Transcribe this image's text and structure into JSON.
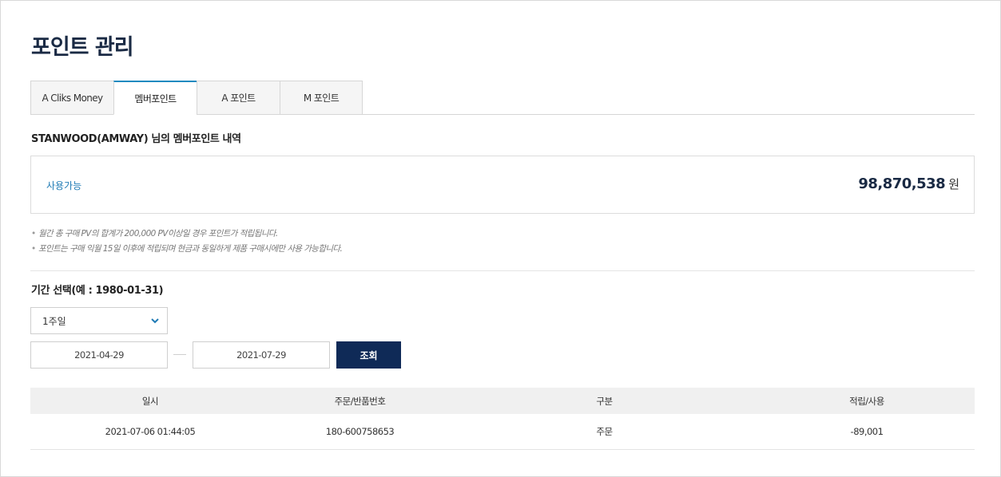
{
  "page": {
    "title": "포인트 관리"
  },
  "tabs": [
    {
      "label": "A Cliks Money",
      "active": false
    },
    {
      "label": "멤버포인트",
      "active": true
    },
    {
      "label": "A 포인트",
      "active": false
    },
    {
      "label": "M 포인트",
      "active": false
    }
  ],
  "summary": {
    "heading": "STANWOOD(AMWAY) 님의 멤버포인트 내역",
    "available_label": "사용가능",
    "amount": "98,870,538",
    "unit": "원"
  },
  "notes": [
    "월간 총 구매 PV의 합계가 200,000 PV이상일 경우 포인트가 적립됩니다.",
    "포인트는 구매 익월 15일 이후에 적립되며 현금과 동일하게 제품 구매시에만 사용 가능합니다."
  ],
  "period": {
    "title": "기간 선택(예 : 1980-01-31)",
    "selected_range": "1주일",
    "start_date": "2021-04-29",
    "end_date": "2021-07-29",
    "search_label": "조회"
  },
  "table": {
    "headers": [
      "일시",
      "주문/반품번호",
      "구분",
      "적립/사용"
    ],
    "rows": [
      [
        "2021-07-06 01:44:05",
        "180-600758653",
        "주문",
        "-89,001"
      ]
    ]
  },
  "colors": {
    "title": "#1a2a44",
    "tab_active_border": "#1f8ac0",
    "label_blue": "#1f7bb5",
    "button_navy": "#0f2a57"
  },
  "icons": {
    "select_arrow": "chevron-down-icon"
  }
}
